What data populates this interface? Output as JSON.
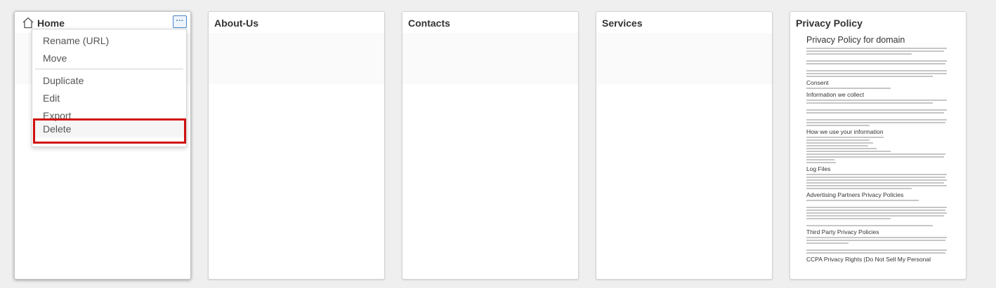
{
  "cards": [
    {
      "id": "home",
      "title": "Home",
      "icon": "home-icon"
    },
    {
      "id": "about",
      "title": "About-Us"
    },
    {
      "id": "contacts",
      "title": "Contacts"
    },
    {
      "id": "services",
      "title": "Services"
    },
    {
      "id": "privacy",
      "title": "Privacy Policy"
    }
  ],
  "more_button": {
    "label": "···",
    "icon": "more-options-icon"
  },
  "context_menu": {
    "items": [
      "Rename (URL)",
      "Move",
      "Duplicate",
      "Edit",
      "Export",
      "Delete"
    ]
  },
  "privacy_preview": {
    "title": "Privacy Policy for domain",
    "headings": [
      "Consent",
      "Information we collect",
      "How we use your information",
      "Log Files",
      "Advertising Partners Privacy Policies",
      "Third Party Privacy Policies",
      "CCPA Privacy Rights (Do Not Sell My Personal"
    ]
  },
  "colors": {
    "highlight": "#d01010",
    "accent": "#4a86c5"
  }
}
